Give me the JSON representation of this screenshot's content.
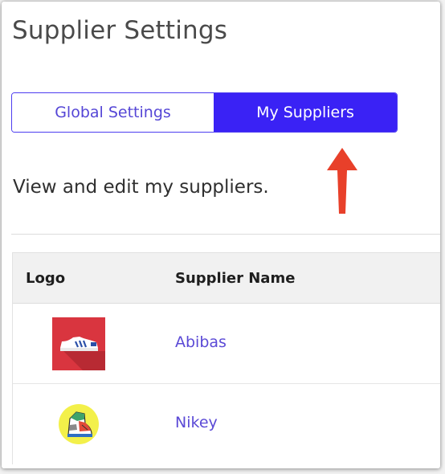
{
  "page": {
    "title": "Supplier Settings",
    "description": "View and edit my suppliers."
  },
  "toggle": {
    "options": [
      {
        "label": "Global Settings",
        "selected": false
      },
      {
        "label": "My Suppliers",
        "selected": true
      }
    ]
  },
  "table": {
    "columns": [
      "Logo",
      "Supplier Name"
    ],
    "rows": [
      {
        "logo_icon": "red-sneaker-logo-icon",
        "name": "Abibas"
      },
      {
        "logo_icon": "yellow-high-top-sneaker-logo-icon",
        "name": "Nikey"
      }
    ]
  },
  "colors": {
    "accent": "#3a22f5",
    "link": "#5b4ad6",
    "arrow": "#e8402a",
    "header_bg": "#f1f1f1"
  }
}
